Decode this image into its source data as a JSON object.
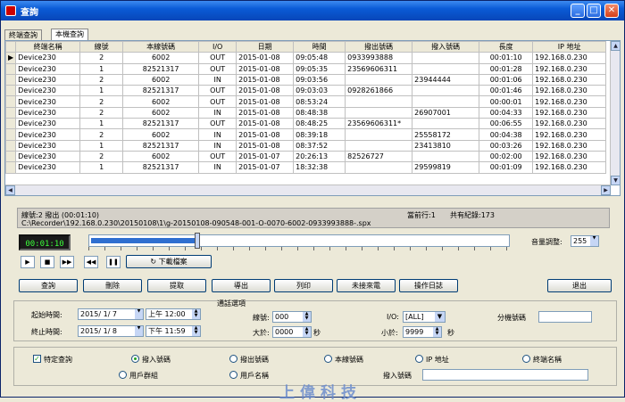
{
  "window": {
    "title": "查詢"
  },
  "tabs": [
    {
      "label": "終端查詢"
    },
    {
      "label": "本機查詢"
    }
  ],
  "grid": {
    "columns": [
      "終端名稱",
      "線號",
      "本線號碼",
      "I/O",
      "日期",
      "時間",
      "撥出號碼",
      "撥入號碼",
      "長度",
      "IP 地址"
    ],
    "rows": [
      [
        "Device230",
        "2",
        "6002",
        "OUT",
        "2015-01-08",
        "09:05:48",
        "0933993888",
        "",
        "00:01:10",
        "192.168.0.230"
      ],
      [
        "Device230",
        "1",
        "82521317",
        "OUT",
        "2015-01-08",
        "09:05:35",
        "23569606311",
        "",
        "00:01:28",
        "192.168.0.230"
      ],
      [
        "Device230",
        "2",
        "6002",
        "IN",
        "2015-01-08",
        "09:03:56",
        "",
        "23944444",
        "00:01:06",
        "192.168.0.230"
      ],
      [
        "Device230",
        "1",
        "82521317",
        "OUT",
        "2015-01-08",
        "09:03:03",
        "0928261866",
        "",
        "00:01:46",
        "192.168.0.230"
      ],
      [
        "Device230",
        "2",
        "6002",
        "OUT",
        "2015-01-08",
        "08:53:24",
        "",
        "",
        "00:00:01",
        "192.168.0.230"
      ],
      [
        "Device230",
        "2",
        "6002",
        "IN",
        "2015-01-08",
        "08:48:38",
        "",
        "26907001",
        "00:04:33",
        "192.168.0.230"
      ],
      [
        "Device230",
        "1",
        "82521317",
        "OUT",
        "2015-01-08",
        "08:48:25",
        "23569606311*",
        "",
        "00:06:55",
        "192.168.0.230"
      ],
      [
        "Device230",
        "2",
        "6002",
        "IN",
        "2015-01-08",
        "08:39:18",
        "",
        "25558172",
        "00:04:38",
        "192.168.0.230"
      ],
      [
        "Device230",
        "1",
        "82521317",
        "IN",
        "2015-01-08",
        "08:37:52",
        "",
        "23413810",
        "00:03:26",
        "192.168.0.230"
      ],
      [
        "Device230",
        "2",
        "6002",
        "OUT",
        "2015-01-07",
        "20:26:13",
        "82526727",
        "",
        "00:02:00",
        "192.168.0.230"
      ],
      [
        "Device230",
        "1",
        "82521317",
        "IN",
        "2015-01-07",
        "18:32:38",
        "",
        "29599819",
        "00:01:09",
        "192.168.0.230"
      ]
    ]
  },
  "player": {
    "line_info": "線號:2  撥出    (00:01:10)",
    "file_path": "C:\\Recorder\\192.168.0.230\\20150108\\1\\g-20150108-090548-001-O-0070-6002-0933993888-.spx",
    "current_row": "當前行:1",
    "total_records": "共有紀錄:173",
    "time_display": "00:01:10",
    "progress": 0.25,
    "download_label": "下載檔案",
    "volume_label": "音量調整:",
    "volume_value": "255"
  },
  "actions": [
    "查詢",
    "刪除",
    "提取",
    "導出",
    "列印",
    "未接來電",
    "操作日誌"
  ],
  "exit_label": "退出",
  "filters": {
    "start_label": "起始時間:",
    "start_date": "2015/ 1/ 7",
    "start_time": "上午 12:00",
    "end_label": "終止時間:",
    "end_date": "2015/ 1/ 8",
    "end_time": "下午 11:59",
    "call_options_label": "通話選項",
    "line_label": "線號:",
    "line_value": "000",
    "greater_label": "大於:",
    "greater_value": "0000",
    "sec1": "秒",
    "io_label": "I/O:",
    "io_value": "[ALL]",
    "less_label": "小於:",
    "less_value": "9999",
    "sec2": "秒",
    "ext_label": "分機號碼",
    "ext_value": ""
  },
  "search": {
    "special_label": "特定查詢",
    "options": [
      "撥入號碼",
      "撥出號碼",
      "本線號碼",
      "IP 地址",
      "終端名稱",
      "用戶群組",
      "用戶名稱"
    ],
    "dial_in_label": "撥入號碼",
    "dial_in_value": ""
  },
  "watermark": "上偉科技"
}
